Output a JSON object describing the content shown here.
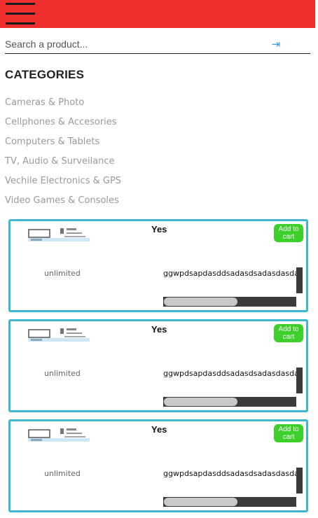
{
  "header": {
    "menu_icon": "hamburger-icon",
    "brand_color": "#ef2e2e"
  },
  "search": {
    "placeholder": "Search a product...",
    "value": "",
    "submit_icon": "arrow-right-to-bar-icon"
  },
  "categories": {
    "title": "CATEGORIES",
    "items": [
      "Cameras & Photo",
      "Cellphones & Accesories",
      "Computers & Tablets",
      "TV, Audio & Surveilance",
      "Vechile Electronics & GPS",
      "Video Games & Consoles"
    ]
  },
  "products": [
    {
      "badge": "Yes",
      "add_label": "Add to cart",
      "stock": "unlimited",
      "description": "ggwpdsapdasddsadasdsadasdasdasdasdasd"
    },
    {
      "badge": "Yes",
      "add_label": "Add to cart",
      "stock": "unlimited",
      "description": "ggwpdsapdasddsadasdsadasdasdasdasdasd"
    },
    {
      "badge": "Yes",
      "add_label": "Add to cart",
      "stock": "unlimited",
      "description": "ggwpdsapdasddsadasdsadasdasdasdasdasd"
    }
  ],
  "colors": {
    "card_border": "#3db8cf",
    "add_button": "#3dcf2a"
  }
}
